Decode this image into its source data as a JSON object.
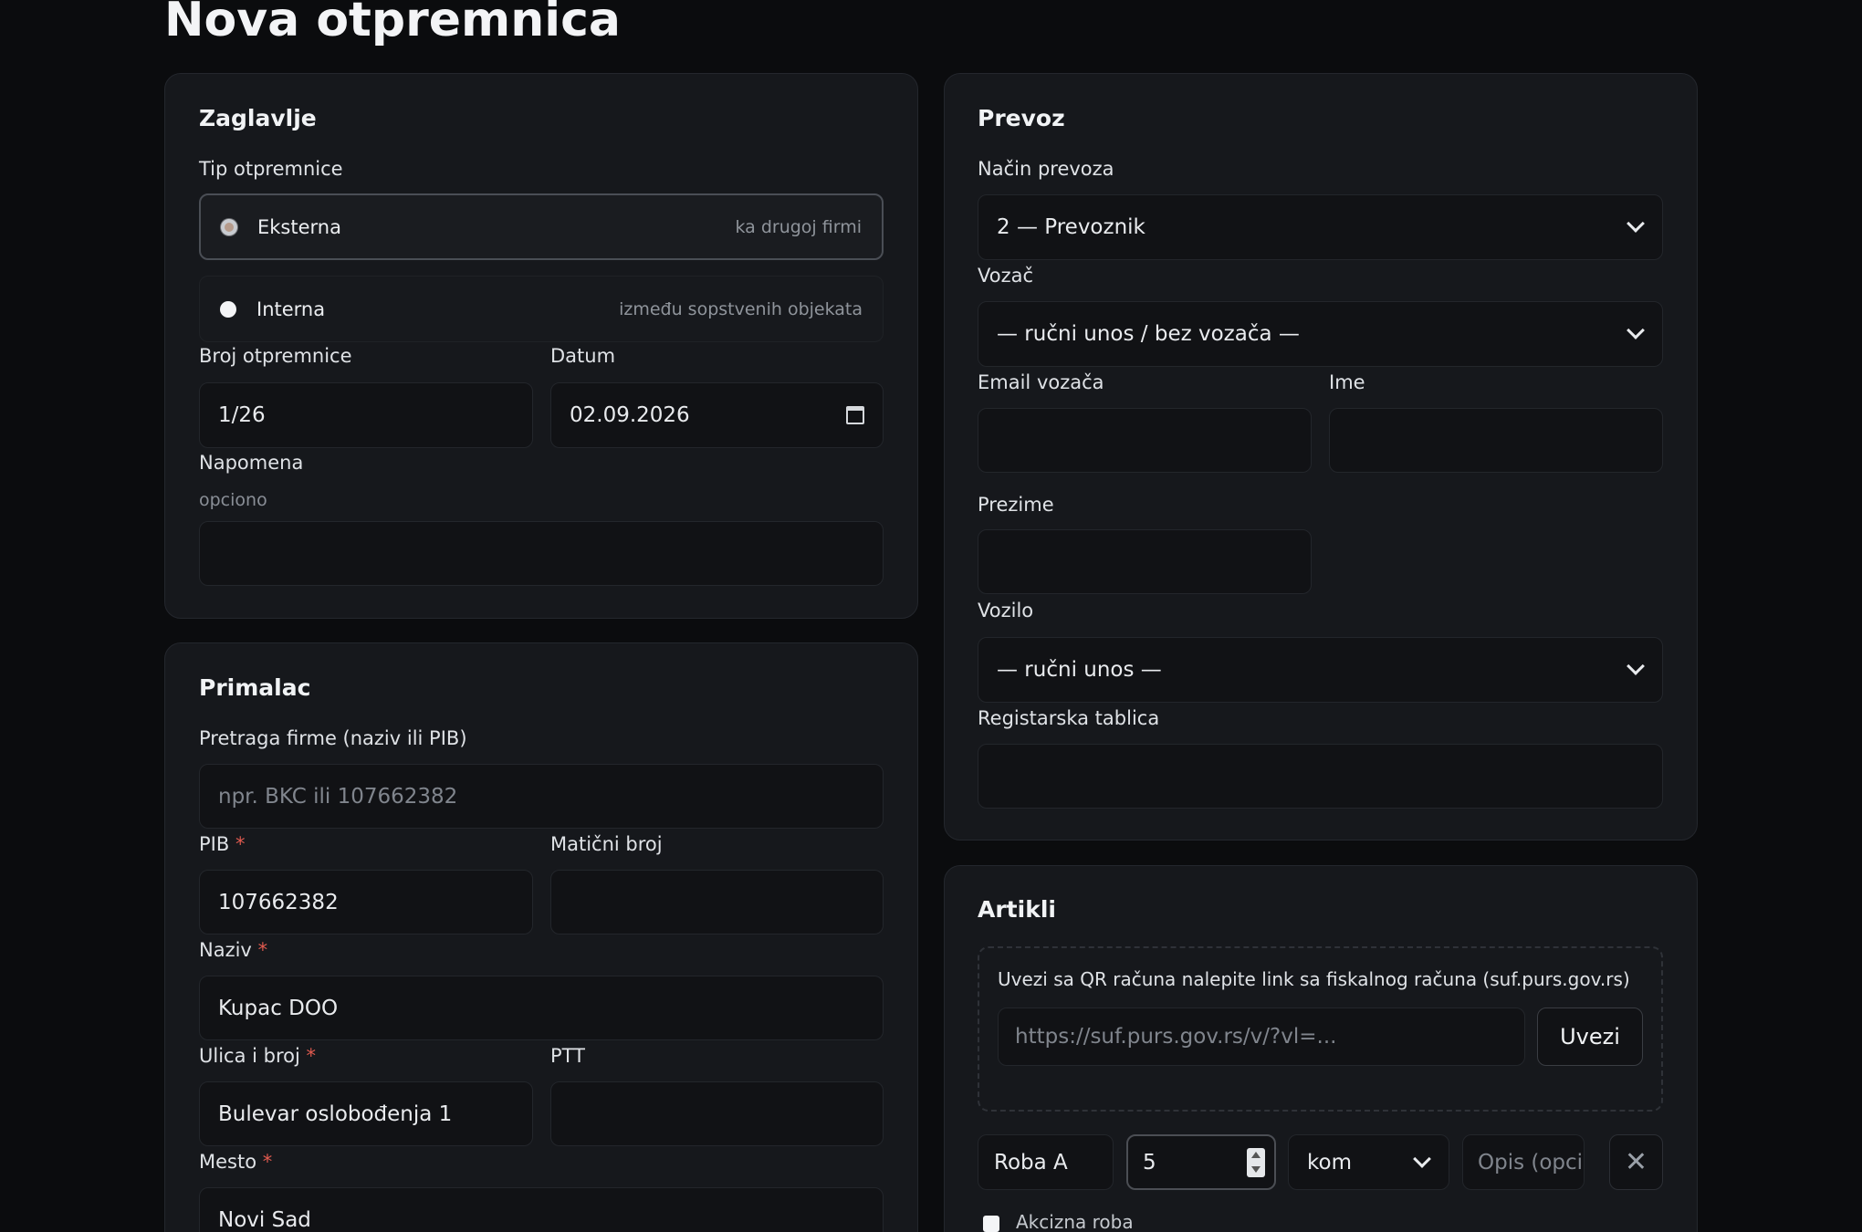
{
  "page": {
    "title": "Nova otpremnica"
  },
  "header_card": {
    "title": "Zaglavlje",
    "type_label": "Tip otpremnice",
    "options": [
      {
        "label": "Eksterna",
        "sub": "ka drugoj firmi",
        "selected": true
      },
      {
        "label": "Interna",
        "sub": "između sopstvenih objekata",
        "selected": false
      }
    ],
    "number_label": "Broj otpremnice",
    "number_value": "1/26",
    "date_label": "Datum",
    "date_value": "02.09.2026",
    "note_label": "Napomena",
    "note_hint": "opciono",
    "note_value": ""
  },
  "recipient_card": {
    "title": "Primalac",
    "search_label": "Pretraga firme (naziv ili PIB)",
    "search_placeholder": "npr. BKC ili 107662382",
    "pib_label": "PIB",
    "pib_value": "107662382",
    "reg_label": "Matični broj",
    "reg_value": "",
    "name_label": "Naziv",
    "name_value": "Kupac DOO",
    "street_label": "Ulica i broj",
    "street_value": "Bulevar oslobođenja 1",
    "zip_label": "PTT",
    "zip_value": "",
    "city_label": "Mesto",
    "city_value": "Novi Sad",
    "required_mark": "*"
  },
  "transport_card": {
    "title": "Prevoz",
    "mode_label": "Način prevoza",
    "mode_value": "2 — Prevoznik",
    "driver_label": "Vozač",
    "driver_value": "— ručni unos / bez vozača —",
    "driver_email_label": "Email vozača",
    "driver_email_value": "",
    "first_name_label": "Ime",
    "first_name_value": "",
    "last_name_label": "Prezime",
    "last_name_value": "",
    "vehicle_label": "Vozilo",
    "vehicle_value": "— ručni unos —",
    "plate_label": "Registarska tablica",
    "plate_value": ""
  },
  "items_card": {
    "title": "Artikli",
    "qr_label": "Uvezi sa QR računa nalepite link sa fiskalnog računa (suf.purs.gov.rs)",
    "qr_placeholder": "https://suf.purs.gov.rs/v/?vl=...",
    "import_button": "Uvezi",
    "item": {
      "name": "Roba A",
      "quantity": "5",
      "unit": "kom",
      "desc_placeholder": "Opis (opcio",
      "promo_label": "Akcizna roba"
    },
    "remove_icon": "close-icon"
  }
}
